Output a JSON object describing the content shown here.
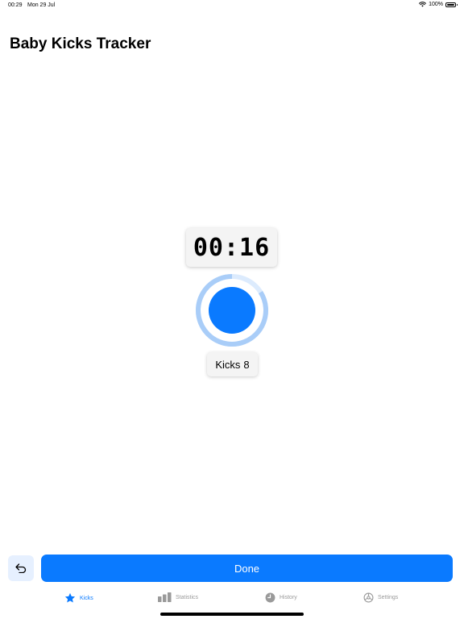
{
  "status_bar": {
    "time": "00:29",
    "date": "Mon 29 Jul",
    "battery": "100%",
    "battery_level": 1.0,
    "wifi_icon": "wifi-icon",
    "battery_icon": "battery-icon"
  },
  "header": {
    "title": "Baby Kicks Tracker"
  },
  "session": {
    "timer": "00:16",
    "kicks_label": "Kicks",
    "kicks_count": "8",
    "progress_fraction": 0.84
  },
  "actions": {
    "undo_icon": "undo-arrow-icon",
    "done_label": "Done"
  },
  "tabs": [
    {
      "label": "Kicks",
      "icon": "star-icon",
      "active": true
    },
    {
      "label": "Statistics",
      "icon": "bar-chart-icon",
      "active": false
    },
    {
      "label": "History",
      "icon": "clock-icon",
      "active": false
    },
    {
      "label": "Settings",
      "icon": "gear-icon",
      "active": false
    }
  ],
  "colors": {
    "accent": "#0a7aff",
    "ring": "#a9cdf8",
    "ring_track": "#dcebfd",
    "inactive_tab": "#9a9a9a"
  }
}
